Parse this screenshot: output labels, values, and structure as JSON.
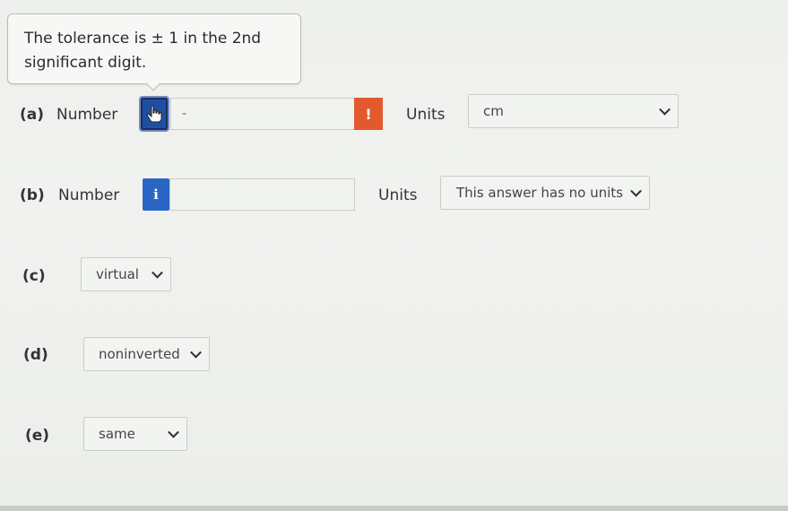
{
  "tooltip": {
    "line1": "The tolerance is ± 1 in the 2nd",
    "line2": "significant digit."
  },
  "parts": {
    "a": {
      "label": "(a)",
      "number_label": "Number",
      "info_icon": "hand-pointer-icon",
      "input_value": "-",
      "warning_glyph": "!",
      "units_label": "Units",
      "units_value": "cm"
    },
    "b": {
      "label": "(b)",
      "number_label": "Number",
      "info_glyph": "i",
      "input_value": "",
      "units_label": "Units",
      "units_value": "This answer has no units"
    },
    "c": {
      "label": "(c)",
      "value": "virtual"
    },
    "d": {
      "label": "(d)",
      "value": "noninverted"
    },
    "e": {
      "label": "(e)",
      "value": "same"
    }
  },
  "colors": {
    "info_blue": "#2a66c4",
    "warning_orange": "#e2592e",
    "background": "#eef0ee"
  }
}
